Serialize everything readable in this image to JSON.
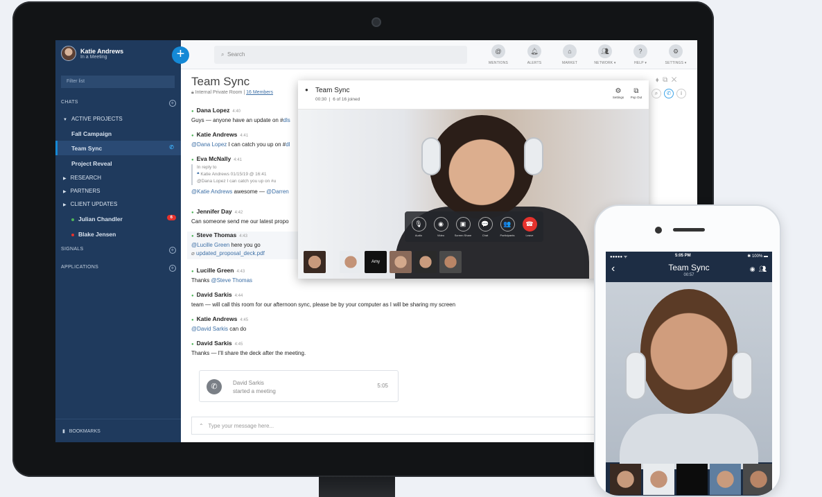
{
  "user": {
    "name": "Katie Andrews",
    "status": "In a Meeting"
  },
  "sidebar": {
    "filter_placeholder": "Filter list",
    "chats_label": "CHATS",
    "active_projects_label": "ACTIVE PROJECTS",
    "items": [
      {
        "label": "Fall Campaign"
      },
      {
        "label": "Team Sync"
      },
      {
        "label": "Project Reveal"
      }
    ],
    "groups": [
      {
        "label": "RESEARCH"
      },
      {
        "label": "PARTNERS"
      },
      {
        "label": "CLIENT UPDATES"
      }
    ],
    "dms": [
      {
        "label": "Julian Chandler",
        "badge": "6",
        "color": "#4fb45a"
      },
      {
        "label": "Blake Jensen",
        "color": "#e5322d"
      }
    ],
    "signals_label": "SIGNALS",
    "applications_label": "APPLICATIONS",
    "bookmarks_label": "BOOKMARKS"
  },
  "topbar": {
    "search_placeholder": "Search",
    "buttons": [
      {
        "label": "MENTIONS",
        "icon": "at-icon"
      },
      {
        "label": "ALERTS",
        "icon": "bell-icon"
      },
      {
        "label": "MARKET",
        "icon": "home-icon"
      },
      {
        "label": "NETWORK ▾",
        "icon": "people-icon"
      },
      {
        "label": "HELP ▾",
        "icon": "help-icon"
      },
      {
        "label": "SETTINGS ▾",
        "icon": "gear-icon"
      }
    ]
  },
  "room": {
    "title": "Team Sync",
    "subtitle": "Internal Private Room",
    "members": "16 Members"
  },
  "messages": [
    {
      "author": "Dana Lopez",
      "time": "4:40",
      "text": "Guys — anyone have an update on #",
      "mention": "dls"
    },
    {
      "author": "Katie Andrews",
      "time": "4:41",
      "mention": "@Dana Lopez",
      "text": " I can catch you up on #",
      "tail": "dl"
    },
    {
      "author": "Eva McNally",
      "time": "4:41",
      "reply_label": "In reply to",
      "reply_meta": "Katie Andrews 01/15/19 @ 16:41",
      "reply_text": "@Dana Lopez I can catch you up on #u",
      "mention": "@Katie Andrews",
      "text": " awesome — ",
      "tail": "@Darren"
    },
    {
      "author": "Jennifer Day",
      "time": "4:42",
      "text": "Can someone send me our latest propo"
    },
    {
      "author": "Steve Thomas",
      "time": "4:43",
      "mention": "@Lucille Green",
      "text": " here you go",
      "file": "updated_proposal_deck.pdf"
    },
    {
      "author": "Lucille Green",
      "time": "4:43",
      "text": "Thanks ",
      "tail": "@Steve Thomas"
    },
    {
      "author": "David Sarkis",
      "time": "4:44",
      "text": "team — will call this room for our afternoon sync, please be by your computer as I will be sharing my screen"
    },
    {
      "author": "Katie Andrews",
      "time": "4:45",
      "mention": "@David Sarkis",
      "text": " can do"
    },
    {
      "author": "David Sarkis",
      "time": "4:45",
      "text": "Thanks — I'll share the deck after the meeting."
    }
  ],
  "call_card": {
    "name": "David Sarkis",
    "status": "started a meeting",
    "time": "5:05"
  },
  "composer": {
    "placeholder": "Type your message here..."
  },
  "video_call": {
    "title": "Team Sync",
    "duration": "00:30",
    "joined": "6 of 16 joined",
    "top_controls": [
      {
        "label": "Settings",
        "icon": "gear-icon"
      },
      {
        "label": "Pop Out",
        "icon": "popout-icon"
      }
    ],
    "controls": [
      {
        "label": "Audio",
        "icon": "mic-icon",
        "glyph": "🎙"
      },
      {
        "label": "Video",
        "icon": "camera-icon",
        "glyph": "◉"
      },
      {
        "label": "Screen Share",
        "icon": "screen-share-icon",
        "glyph": "▣"
      },
      {
        "label": "Chat",
        "icon": "chat-icon",
        "glyph": "💬"
      },
      {
        "label": "Participants",
        "icon": "participants-icon",
        "glyph": "👥"
      },
      {
        "label": "Leave",
        "icon": "hangup-icon",
        "glyph": "☎"
      }
    ],
    "thumb_label": "Amy"
  },
  "phone": {
    "status_time": "5:05 PM",
    "battery": "100%",
    "title": "Team Sync",
    "timer": "00:57"
  }
}
